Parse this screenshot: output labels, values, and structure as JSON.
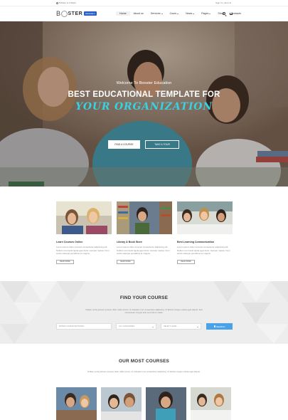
{
  "topbar": {
    "hours": "8:00am to 6:30pm",
    "auth": "Sign In / Join Us"
  },
  "logo": {
    "text_b": "B",
    "text_ster": "STER",
    "badge": "Education"
  },
  "nav": {
    "items": [
      "Home",
      "About us",
      "Services",
      "Cours",
      "News",
      "Pages",
      "Shop",
      "Contacts"
    ]
  },
  "hero": {
    "welcome": "Welcome To Booster Education",
    "headline": "BEST EDUCATIONAL TEMPLATE FOR",
    "script": "YOUR ORGANIZATION",
    "btn_primary": "FIND A COURSE",
    "btn_secondary": "TAKE A TOUR"
  },
  "features": [
    {
      "title": "Learn Courses Online",
      "text": "Lorem ipsum dolor sit amet consectetur adipiscing elit. Nullam commodo ligula eget dolor. Aenean massa. Cum sociis natoque penatibus et magnis.",
      "more": "READ MORE"
    },
    {
      "title": "Library & Book Store",
      "text": "Lorem ipsum dolor sit amet consectetur adipiscing elit. Nullam commodo ligula eget dolor. Aenean massa. Cum sociis natoque penatibus et magnis.",
      "more": "READ MORE"
    },
    {
      "title": "Best Learning Communication",
      "text": "Lorem ipsum dolor sit amet consectetur adipiscing elit. Nullam commodo ligula eget dolor. Aenean massa. Cum sociis natoque penatibus et magnis.",
      "more": "READ MORE"
    }
  ],
  "find": {
    "heading": "FIND YOUR COURSE",
    "sub": "Nullam porta posuere semper dolor nulla cursus. Ut volutpat mi ac consectetur adipiscing. Ut lacinia congue massa eget aliquet. Sed consectetur congue ante sed rutrum mattis.",
    "field_keyword": "ENTER COURSE KEYWORD...",
    "field_category": "ALL CATEGORIES",
    "field_level": "SELECT LEVEL",
    "search": "SEARCH"
  },
  "courses": {
    "heading": "OUR MOST COURSES",
    "sub": "Nullam porta posuere semper dolor nulla cursus. Ut volutpat mi ac consectetur adipiscing. Ut lacinia congue massa eget aliquet."
  },
  "colors": {
    "accent": "#3ad0e0",
    "button_blue": "#4aa3e8",
    "badge_blue": "#2b5ec7"
  }
}
